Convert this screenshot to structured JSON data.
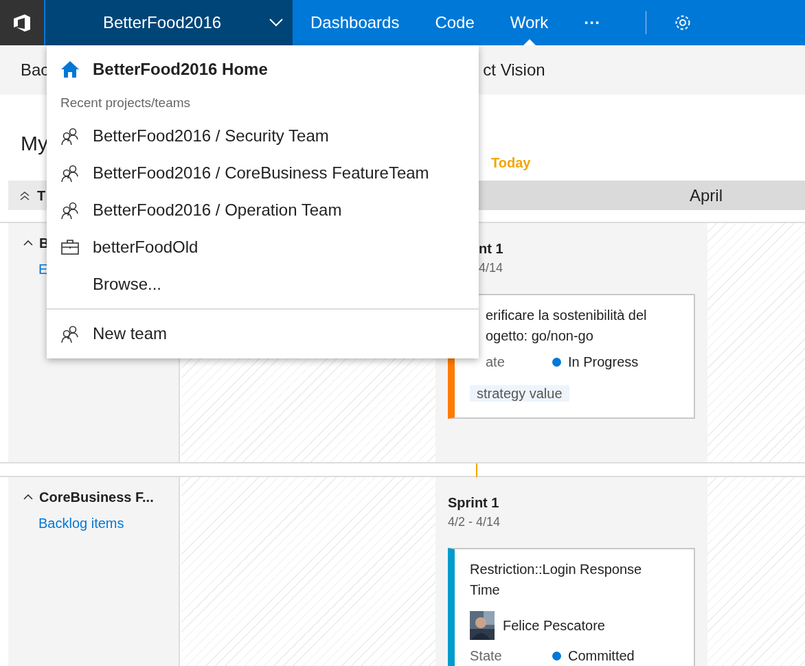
{
  "top_bar": {
    "project": "BetterFood2016",
    "hubs": [
      {
        "label": "Dashboards",
        "selected": false
      },
      {
        "label": "Code",
        "selected": false
      },
      {
        "label": "Work",
        "selected": true
      }
    ],
    "more": "···"
  },
  "sub_nav": [
    {
      "label": "Bac"
    },
    {
      "label": "ct Vision"
    }
  ],
  "page_title": "My",
  "today_label": "Today",
  "timeline_header": {
    "column_1": "T",
    "month": "April"
  },
  "teams": [
    {
      "name": "B",
      "expanded": true,
      "link": "E",
      "sprint": {
        "name": "nt 1",
        "dates": "4/14"
      },
      "card": {
        "title_lines": [
          "erificare la sostenibilità del",
          "ogetto: go/non-go"
        ],
        "color": "#ff7b00",
        "state_label": "ate",
        "state": "In Progress",
        "tag": "strategy value"
      }
    },
    {
      "name": "CoreBusiness F...",
      "expanded": true,
      "link": "Backlog items",
      "sprint": {
        "name": "Sprint 1",
        "dates": "4/2 - 4/14"
      },
      "card": {
        "title_lines": [
          "Restriction::Login Response",
          "Time"
        ],
        "color": "#009ccc",
        "assignee": "Felice Pescatore",
        "state_label": "State",
        "state": "Committed"
      }
    }
  ],
  "project_menu": {
    "home": "BetterFood2016 Home",
    "section_label": "Recent projects/teams",
    "items": [
      {
        "kind": "team",
        "label": "BetterFood2016 / Security Team"
      },
      {
        "kind": "team",
        "label": "BetterFood2016 / CoreBusiness FeatureTeam"
      },
      {
        "kind": "team",
        "label": "BetterFood2016 / Operation Team"
      },
      {
        "kind": "project",
        "label": "betterFoodOld"
      },
      {
        "kind": "link",
        "label": "Browse..."
      }
    ],
    "footer": [
      {
        "kind": "team",
        "label": "New team"
      }
    ]
  }
}
